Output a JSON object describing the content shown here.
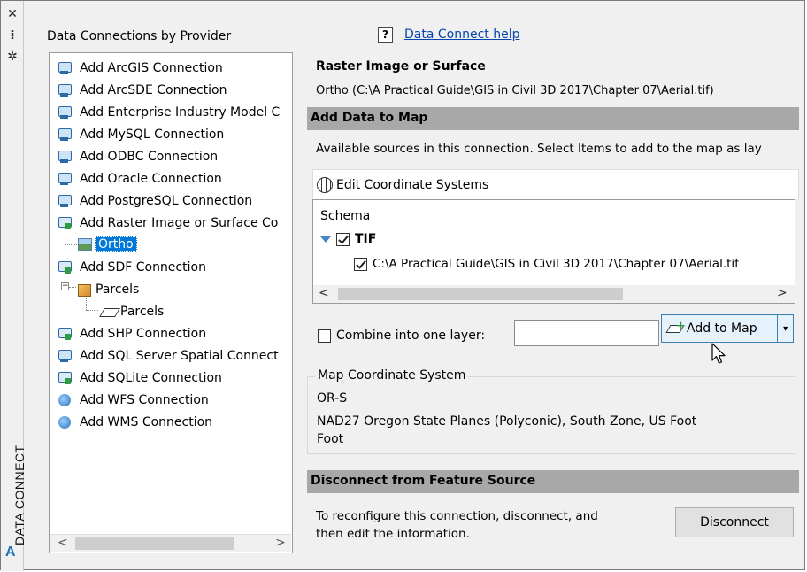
{
  "palette": {
    "close_glyph": "✕",
    "pin_glyph": "⁞",
    "settings_glyph": "✲",
    "vertical_title": "DATA CONNECT",
    "logo_letter": "A"
  },
  "left_panel": {
    "title": "Data Connections by Provider",
    "tree": [
      {
        "label": "Add ArcGIS Connection",
        "icon": "db-connection-icon"
      },
      {
        "label": "Add ArcSDE Connection",
        "icon": "db-connection-icon"
      },
      {
        "label": "Add Enterprise Industry Model C",
        "icon": "db-connection-icon"
      },
      {
        "label": "Add MySQL Connection",
        "icon": "db-connection-icon"
      },
      {
        "label": "Add ODBC Connection",
        "icon": "db-connection-icon"
      },
      {
        "label": "Add Oracle Connection",
        "icon": "db-connection-icon"
      },
      {
        "label": "Add PostgreSQL Connection",
        "icon": "db-connection-icon"
      },
      {
        "label": "Add Raster Image or Surface Co",
        "icon": "raster-connection-icon"
      },
      {
        "label": "Ortho",
        "icon": "raster-image-icon",
        "selected": true
      },
      {
        "label": "Add SDF Connection",
        "icon": "file-connection-icon"
      },
      {
        "label": "Parcels",
        "icon": "feature-class-icon"
      },
      {
        "label": "Parcels",
        "icon": "polygon-layer-icon"
      },
      {
        "label": "Add SHP Connection",
        "icon": "file-connection-icon"
      },
      {
        "label": "Add SQL Server Spatial Connect",
        "icon": "db-connection-icon"
      },
      {
        "label": "Add SQLite Connection",
        "icon": "file-connection-icon"
      },
      {
        "label": "Add WFS Connection",
        "icon": "web-globe-icon"
      },
      {
        "label": "Add WMS Connection",
        "icon": "web-globe-icon"
      }
    ],
    "expander_glyph": "−",
    "scroll_left": "<",
    "scroll_right": ">"
  },
  "help": {
    "icon_glyph": "?",
    "link_text": "Data Connect help"
  },
  "source": {
    "title": "Raster Image or Surface",
    "path": "Ortho (C:\\A Practical Guide\\GIS in Civil 3D 2017\\Chapter 07\\Aerial.tif)"
  },
  "add_data": {
    "section_title": "Add Data to Map",
    "instructions": "Available sources in this connection.  Select Items to add to the map as lay",
    "edit_coord_label": "Edit Coordinate Systems",
    "schema_label": "Schema",
    "schema_node": "TIF",
    "schema_file": "C:\\A Practical Guide\\GIS in Civil 3D 2017\\Chapter 07\\Aerial.tif",
    "scroll_left": "<",
    "scroll_right": ">",
    "combine_label": "Combine into one layer:",
    "combine_value": "",
    "add_to_map_label": "Add to Map",
    "dropdown_glyph": "▾"
  },
  "coordinate_system": {
    "legend": "Map Coordinate System",
    "code": "OR-S",
    "description_line1": "NAD27 Oregon State Planes (Polyconic), South Zone, US Foot",
    "description_line2": "Foot"
  },
  "disconnect": {
    "section_title": "Disconnect from Feature Source",
    "text_line1": "To reconfigure this connection, disconnect, and",
    "text_line2": "then edit the information.",
    "button_label": "Disconnect"
  },
  "colors": {
    "selection": "#0078d7",
    "section_bar": "#a8a8a8",
    "link": "#0645ad",
    "button_hover": "#e5f1fb"
  }
}
